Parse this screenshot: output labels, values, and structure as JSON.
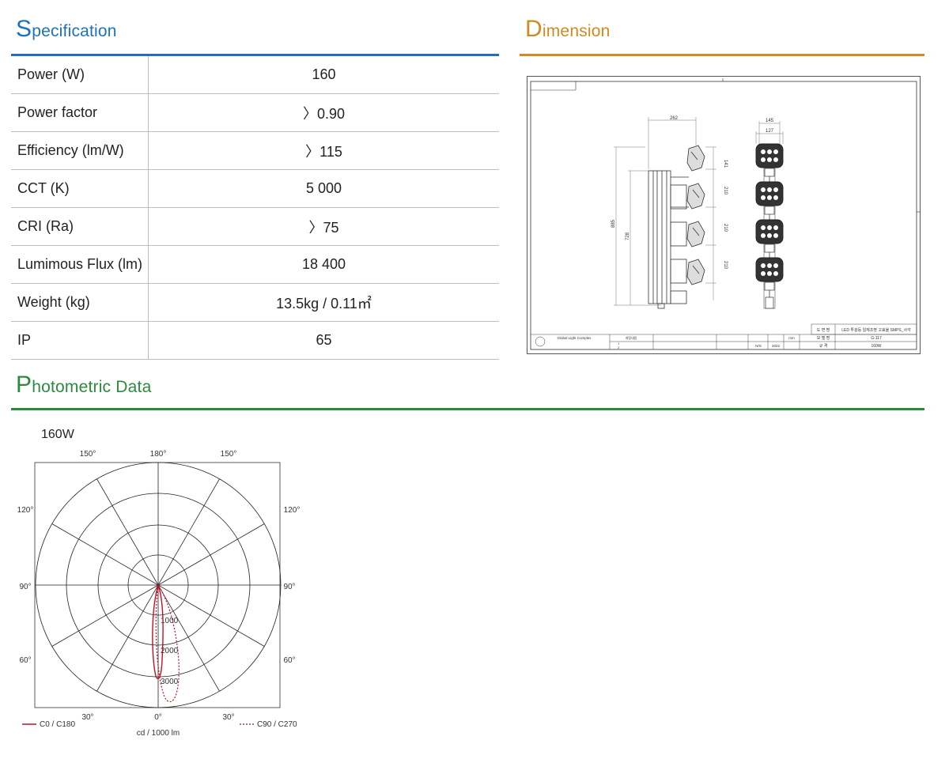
{
  "spec": {
    "title_cap": "S",
    "title_rest": "pecification",
    "rows": [
      {
        "label": "Power (W)",
        "value": "160"
      },
      {
        "label": "Power factor",
        "value": "〉0.90"
      },
      {
        "label": "Efficiency (lm/W)",
        "value": "〉115"
      },
      {
        "label": "CCT (K)",
        "value": "5 000"
      },
      {
        "label": "CRI (Ra)",
        "value": "〉75"
      },
      {
        "label": "Lumimous Flux (lm)",
        "value": "18 400"
      },
      {
        "label": "Weight (kg)",
        "value": "13.5kg / 0.11㎡"
      },
      {
        "label": "IP",
        "value": "65"
      }
    ]
  },
  "dimension": {
    "title_cap": "D",
    "title_rest": "imension",
    "dims": {
      "top_width": "262",
      "side_width_outer": "145",
      "side_width_inner": "127",
      "first_gap": "141",
      "gap_1": "210",
      "gap_2": "210",
      "gap_3": "210",
      "total_height": "885",
      "pole_height": "728"
    },
    "title_block": {
      "drawing_name_label": "도 면 명",
      "drawing_name": "LED 투광등 일체조명 고효율 SMPS_사각",
      "model_label": "모 델 명",
      "model": "G-117",
      "spec_label": "규 격",
      "spec": "160W",
      "unit": "mm",
      "scale": "N/S",
      "year": "2022",
      "company": "Global Light Complex",
      "rev_1": "1",
      "rev_2": "2",
      "rev_header": "개정내용"
    }
  },
  "photometric": {
    "title_cap": "P",
    "title_rest": "hotometric Data",
    "power_label": "160W",
    "angle_labels": {
      "top_left": "150°",
      "top_center": "180°",
      "top_right": "150°",
      "upper_left": "120°",
      "upper_right": "120°",
      "mid_left": "90°",
      "mid_right": "90°",
      "lower_left": "60°",
      "lower_right": "60°",
      "bottom_left": "30°",
      "bottom_center": "0°",
      "bottom_right": "30°"
    },
    "ring_labels": [
      "1000",
      "2000",
      "3000"
    ],
    "unit_label": "cd / 1000 lm",
    "legend": {
      "c0": "C0 / C180",
      "c90": "C90 / C270"
    },
    "colors": {
      "c0": "#c1121f",
      "c90": "#c1121f"
    }
  }
}
